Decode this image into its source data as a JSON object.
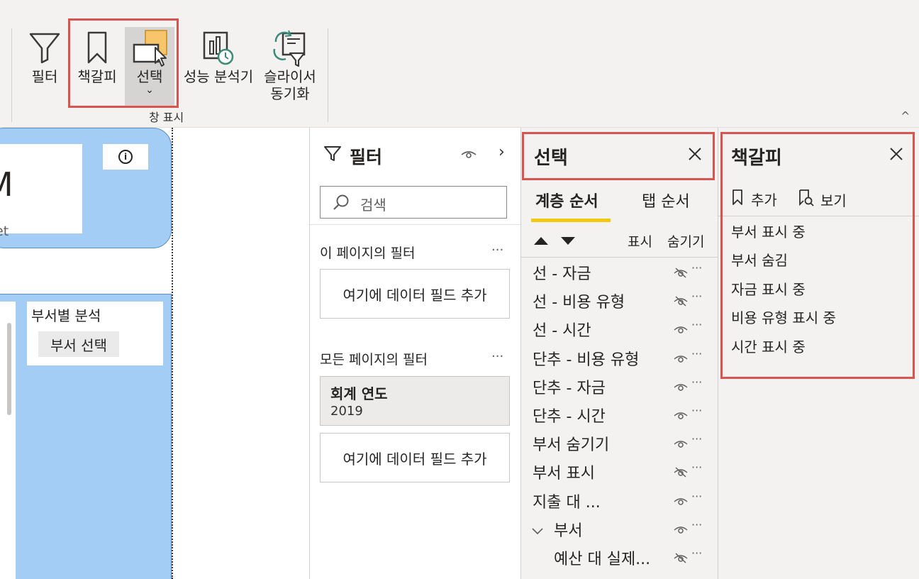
{
  "ribbon": {
    "buttons": [
      {
        "label": "필터",
        "icon": "filter-icon"
      },
      {
        "label": "책갈피",
        "icon": "bookmark-icon"
      },
      {
        "label": "선택",
        "icon": "selection-icon",
        "chevron": "⌄"
      },
      {
        "label": "성능 분석기",
        "icon": "performance-analyzer-icon"
      },
      {
        "label": "슬라이서\n동기화",
        "line1": "슬라이서",
        "line2": "동기화",
        "icon": "sync-slicers-icon"
      }
    ],
    "group_label": "창 표시",
    "collapse_glyph": "^"
  },
  "canvas": {
    "card_big_text": "M",
    "card_small_text": "get",
    "info_glyph": "i",
    "slicer_title": "부서별 분석",
    "slicer_button": "부서 선택"
  },
  "filter_pane": {
    "title": "필터",
    "search_placeholder": "검색",
    "page_filters_label": "이 페이지의 필터",
    "all_pages_label": "모든 페이지의 필터",
    "drop_zone_text": "여기에 데이터 필드 추가",
    "more": "···",
    "fiscal_year": {
      "title": "회계 연도",
      "value": "2019"
    }
  },
  "selection_pane": {
    "title": "선택",
    "tabs": {
      "layer_order": "계층 순서",
      "tab_order": "탭 순서"
    },
    "show": "표시",
    "hide": "숨기기",
    "more": "···",
    "items": [
      {
        "name": "선 - 자금",
        "hidden": true
      },
      {
        "name": "선 - 비용 유형",
        "hidden": true
      },
      {
        "name": "선 - 시간",
        "hidden": false
      },
      {
        "name": "단추 - 비용 유형",
        "hidden": false
      },
      {
        "name": "단추 - 자금",
        "hidden": false
      },
      {
        "name": "단추 - 시간",
        "hidden": false
      },
      {
        "name": "부서 숨기기",
        "hidden": false
      },
      {
        "name": "부서 표시",
        "hidden": true
      },
      {
        "name": "지출 대 ...",
        "hidden": false
      },
      {
        "name": "부서",
        "hidden": false,
        "group": true
      },
      {
        "name": "예산 대 실제...",
        "hidden": true,
        "child": true
      }
    ]
  },
  "bookmark_pane": {
    "title": "책갈피",
    "add": "추가",
    "view": "보기",
    "items": [
      "부서 표시 중",
      "부서 숨김",
      "자금 표시 중",
      "비용 유형 표시 중",
      "시간 표시 중"
    ]
  },
  "colors": {
    "highlight": "#d9534f",
    "card_blue": "#a4cdf6",
    "tab_underline": "#f2c811",
    "ribbon_bg": "#f3f2f1"
  }
}
